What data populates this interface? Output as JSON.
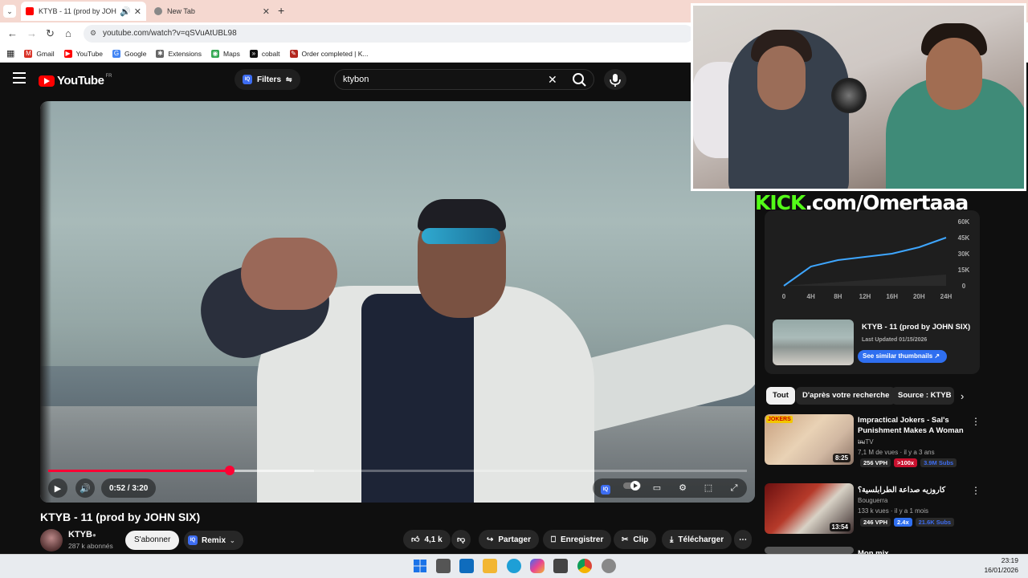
{
  "browser": {
    "tabs": [
      {
        "label": "KTYB - 11 (prod by JOHN SIX)",
        "active": true
      },
      {
        "label": "New Tab",
        "active": false
      }
    ],
    "url": "youtube.com/watch?v=qSVuAtUBL98",
    "bookmarks": [
      "Gmail",
      "YouTube",
      "Google",
      "Extensions",
      "Maps",
      "cobalt",
      "Order completed | K..."
    ]
  },
  "header": {
    "logo": "YouTube",
    "country": "FR",
    "filters_label": "Filters",
    "search_value": "ktybon"
  },
  "player": {
    "time": "0:52 / 3:20",
    "progress_fraction": 0.26,
    "buffered_fraction": 0.38
  },
  "video": {
    "title": "KTYB - 11 (prod by JOHN SIX)",
    "channel": "KTYB",
    "subscribers": "287 k abonnés",
    "subscribe_label": "S'abonner",
    "remix_label": "Remix",
    "likes": "4,1 k",
    "share_label": "Partager",
    "save_label": "Enregistrer",
    "clip_label": "Clip",
    "download_label": "Télécharger"
  },
  "overlay": {
    "kick_brand": "KICK",
    "kick_rest": ".com/Omertaaa"
  },
  "stats_panel": {
    "thumb_title": "KTYB - 11 (prod by JOHN SIX)",
    "last_updated": "Last Updated 01/15/2026",
    "similar_label": "See similar thumbnails ↗"
  },
  "chart_data": {
    "type": "line",
    "x": [
      "0",
      "4H",
      "8H",
      "12H",
      "16H",
      "20H",
      "24H"
    ],
    "ylabel_ticks": [
      "0",
      "15K",
      "30K",
      "45K",
      "60K"
    ],
    "values": [
      0,
      18000,
      24000,
      27000,
      30000,
      36000,
      45000
    ],
    "ylim": [
      0,
      60000
    ],
    "grid": false,
    "color": "#3ea6ff"
  },
  "chips": [
    "Tout",
    "D'après votre recherche",
    "Source : KTYB"
  ],
  "recommendations": [
    {
      "title": "Impractical Jokers - Sal's Punishment Makes A Woman ...",
      "channel": "truTV",
      "meta": "7,1 M de vues · il y a 3 ans",
      "duration": "8:25",
      "vph": "256 VPH",
      "mult": ">100x",
      "subs": "3.9M Subs",
      "badge": "JOKERS"
    },
    {
      "title": "كاروزيه صداعة الطرابلسية؟",
      "channel": "Bouguerra",
      "meta": "133 k vues · il y a 1 mois",
      "duration": "13:54",
      "vph": "246 VPH",
      "mult": "2.4x",
      "subs": "21.6K Subs"
    },
    {
      "title": "Mon mix"
    }
  ],
  "taskbar": {
    "time": "23:19",
    "date": "16/01/2026"
  }
}
